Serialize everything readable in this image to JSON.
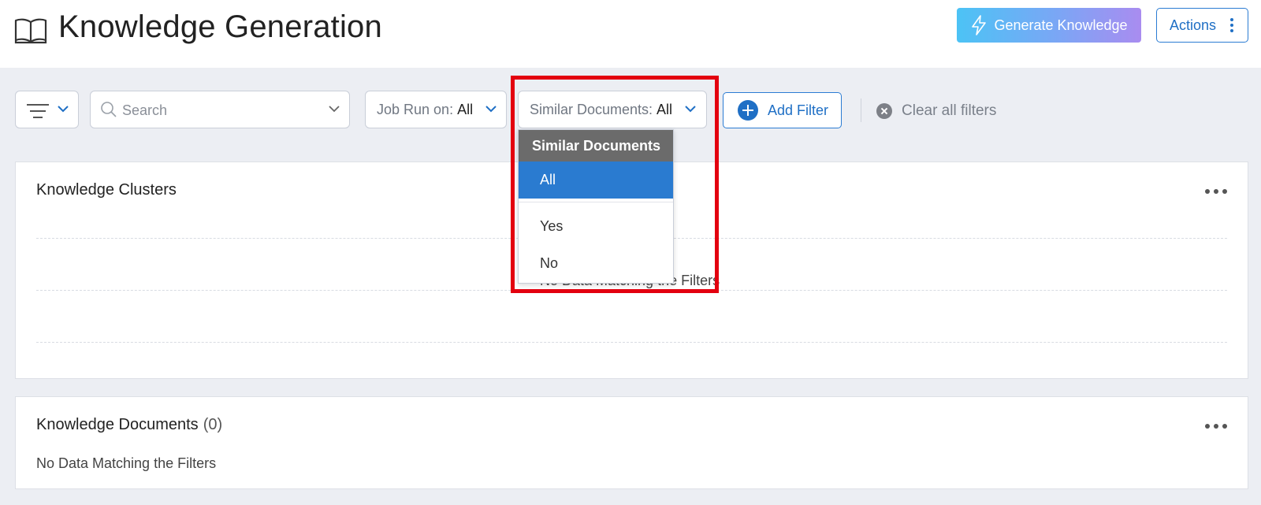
{
  "header": {
    "title": "Knowledge Generation",
    "icon": "book-open-icon",
    "generate_label": "Generate Knowledge",
    "generate_icon": "lightning-icon",
    "actions_label": "Actions"
  },
  "filters": {
    "search_placeholder": "Search",
    "job_run_label": "Job Run on:",
    "job_run_value": "All",
    "similar_docs_label": "Similar Documents:",
    "similar_docs_value": "All",
    "add_filter_label": "Add Filter",
    "clear_all_label": "Clear all filters"
  },
  "dropdown": {
    "header": "Similar Documents",
    "options": [
      "All",
      "Yes",
      "No"
    ],
    "selected": "All"
  },
  "clusters": {
    "title": "Knowledge Clusters",
    "empty_message": "No Data Matching the Filters"
  },
  "documents": {
    "title": "Knowledge Documents",
    "count": "(0)",
    "empty_message": "No Data Matching the Filters"
  },
  "colors": {
    "accent": "#1f6fc5",
    "selected_option": "#2a7bd0",
    "highlight_box": "#e3000f",
    "background": "#eceef3"
  }
}
